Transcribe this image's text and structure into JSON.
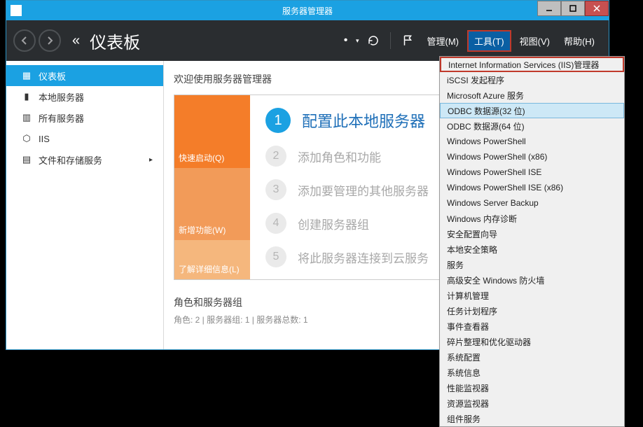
{
  "window": {
    "title": "服务器管理器",
    "minimize_label": "−",
    "maximize_label": "□",
    "close_label": "×"
  },
  "toolbar": {
    "angles": "«",
    "title": "仪表板",
    "dropdown_caret": "▾",
    "separator": "|",
    "menu": {
      "manage": "管理(M)",
      "tools": "工具(T)",
      "view": "视图(V)",
      "help": "帮助(H)"
    }
  },
  "sidebar": {
    "items": [
      {
        "icon": "dashboard",
        "label": "仪表板",
        "caret": ""
      },
      {
        "icon": "server",
        "label": "本地服务器",
        "caret": ""
      },
      {
        "icon": "servers",
        "label": "所有服务器",
        "caret": ""
      },
      {
        "icon": "iis",
        "label": "IIS",
        "caret": ""
      },
      {
        "icon": "storage",
        "label": "文件和存储服务",
        "caret": "▸"
      }
    ]
  },
  "main": {
    "welcome_title": "欢迎使用服务器管理器",
    "quickstart": {
      "section1": "快速启动(Q)",
      "section2": "新增功能(W)",
      "section3": "了解详细信息(L)"
    },
    "steps": [
      {
        "num": "1",
        "text": "配置此本地服务器"
      },
      {
        "num": "2",
        "text": "添加角色和功能"
      },
      {
        "num": "3",
        "text": "添加要管理的其他服务器"
      },
      {
        "num": "4",
        "text": "创建服务器组"
      },
      {
        "num": "5",
        "text": "将此服务器连接到云服务"
      }
    ],
    "roles_title": "角色和服务器组",
    "roles_sub": "角色: 2 | 服务器组: 1 | 服务器总数: 1"
  },
  "tools_menu": {
    "items": [
      "Internet Information Services (IIS)管理器",
      "iSCSI 发起程序",
      "Microsoft Azure 服务",
      "ODBC 数据源(32 位)",
      "ODBC 数据源(64 位)",
      "Windows PowerShell",
      "Windows PowerShell (x86)",
      "Windows PowerShell ISE",
      "Windows PowerShell ISE (x86)",
      "Windows Server Backup",
      "Windows 内存诊断",
      "安全配置向导",
      "本地安全策略",
      "服务",
      "高级安全 Windows 防火墙",
      "计算机管理",
      "任务计划程序",
      "事件查看器",
      "碎片整理和优化驱动器",
      "系统配置",
      "系统信息",
      "性能监视器",
      "资源监视器",
      "组件服务"
    ]
  }
}
